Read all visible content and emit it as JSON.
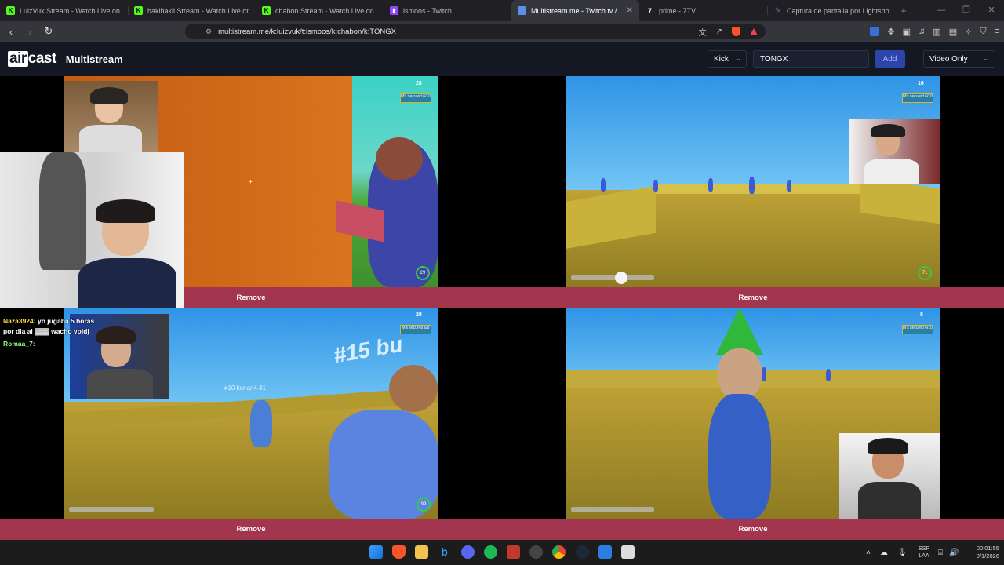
{
  "browser": {
    "tabs": [
      {
        "label": "LuizVuk Stream - Watch Live on",
        "favicon": "kick-icon",
        "color": "#53fc18"
      },
      {
        "label": "hakihakii Stream - Watch Live on",
        "favicon": "kick-icon",
        "color": "#53fc18"
      },
      {
        "label": "chabon Stream - Watch Live on",
        "favicon": "kick-icon",
        "color": "#53fc18"
      },
      {
        "label": "lsmoos - Twitch",
        "favicon": "twitch-icon",
        "color": "#9146ff"
      },
      {
        "label": "Multistream.me - Twitch.tv /",
        "favicon": "multistream-icon",
        "color": "#5c8ee6",
        "active": true
      },
      {
        "label": "prime - 7TV",
        "favicon": "7tv-icon",
        "color": "#ffffff"
      },
      {
        "label": "Captura de pantalla por Lightshot",
        "favicon": "lightshot-icon",
        "color": "#b04fd6"
      }
    ],
    "new_tab_glyph": "+",
    "url": "multistream.me/k:luizvuk/t:ismoos/k:chabon/k:TONGX"
  },
  "site": {
    "logo_air": "air",
    "logo_cast": "cast",
    "title": "Multistream",
    "platform_select": "Kick",
    "channel_input_value": "TONGX",
    "add_label": "Add",
    "mode_select": "Video Only"
  },
  "streams": [
    {
      "remove_label": "Remove",
      "hud_count": "28",
      "hud_box": "M's secured 6/10",
      "ring": "29"
    },
    {
      "remove_label": "Remove",
      "hud_count": "16",
      "hud_box": "M's secured 6/10",
      "ring": "71"
    },
    {
      "remove_label": "Remove",
      "hud_count": "28",
      "hud_box": "M's secured 6/8",
      "ring": "99",
      "overlay_text": "#15 bu",
      "name_tag": "#10 kenan4.41"
    },
    {
      "remove_label": "Remove",
      "hud_count": "8",
      "hud_box": "M's secured 6/10"
    }
  ],
  "chat": {
    "messages": [
      {
        "user": "Naza3924:",
        "text": "yo jugaba 5 horas"
      },
      {
        "user": "",
        "text": "por dia al ▓▓▓ wacho voidj"
      },
      {
        "user": "Romaa_7:",
        "text": ""
      }
    ]
  },
  "taskbar": {
    "lang_line1": "ESP",
    "lang_line2": "LAA",
    "time": "00:01:55",
    "date": "9/1/2026"
  }
}
